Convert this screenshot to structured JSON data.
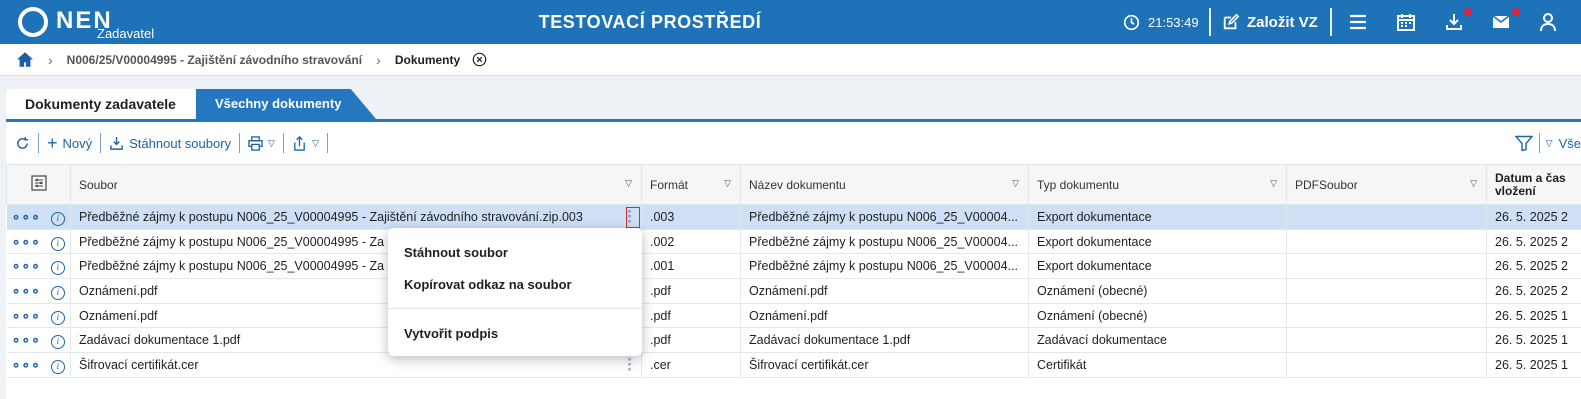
{
  "header": {
    "logo_text": "NEN",
    "logo_sub": "Zadavatel",
    "env_title": "TESTOVACÍ PROSTŘEDÍ",
    "time": "21:53:49",
    "create_label": "Založit VZ",
    "accent": "#1d72b8"
  },
  "breadcrumb": {
    "items": [
      "N006/25/V00004995 - Zajištění závodního stravování",
      "Dokumenty"
    ]
  },
  "tabs": [
    {
      "label": "Dokumenty zadavatele"
    },
    {
      "label": "Všechny dokumenty"
    }
  ],
  "toolbar": {
    "new_label": "Nový",
    "download_label": "Stáhnout soubory",
    "filter_all_label": "Vše"
  },
  "table": {
    "columns": [
      "Soubor",
      "Formát",
      "Název dokumentu",
      "Typ dokumentu",
      "PDFSoubor",
      "Datum a čas vložení"
    ],
    "rows": [
      {
        "file": "Předběžné zájmy k postupu N006_25_V00004995 - Zajištění závodního stravování.zip.003",
        "format": ".003",
        "name": "Předběžné zájmy k postupu N006_25_V00004...",
        "type": "Export dokumentace",
        "pdf": "",
        "date": "26. 5. 2025 2"
      },
      {
        "file": "Předběžné zájmy k postupu N006_25_V00004995 - Za",
        "format": ".002",
        "name": "Předběžné zájmy k postupu N006_25_V00004...",
        "type": "Export dokumentace",
        "pdf": "",
        "date": "26. 5. 2025 2"
      },
      {
        "file": "Předběžné zájmy k postupu N006_25_V00004995 - Za",
        "format": ".001",
        "name": "Předběžné zájmy k postupu N006_25_V00004...",
        "type": "Export dokumentace",
        "pdf": "",
        "date": "26. 5. 2025 2"
      },
      {
        "file": "Oznámení.pdf",
        "format": ".pdf",
        "name": "Oznámení.pdf",
        "type": "Oznámení (obecné)",
        "pdf": "",
        "date": "26. 5. 2025 2"
      },
      {
        "file": "Oznámení.pdf",
        "format": ".pdf",
        "name": "Oznámení.pdf",
        "type": "Oznámení (obecné)",
        "pdf": "",
        "date": "26. 5. 2025 1"
      },
      {
        "file": "Zadávací dokumentace 1.pdf",
        "format": ".pdf",
        "name": "Zadávací dokumentace 1.pdf",
        "type": "Zadávací dokumentace",
        "pdf": "",
        "date": "26. 5. 2025 1"
      },
      {
        "file": "Šifrovací certifikát.cer",
        "format": ".cer",
        "name": "Šifrovací certifikát.cer",
        "type": "Certifikát",
        "pdf": "",
        "date": "26. 5. 2025 1"
      }
    ]
  },
  "context_menu": {
    "items": [
      "Stáhnout soubor",
      "Kopírovat odkaz na soubor",
      "Vytvořit podpis"
    ]
  }
}
